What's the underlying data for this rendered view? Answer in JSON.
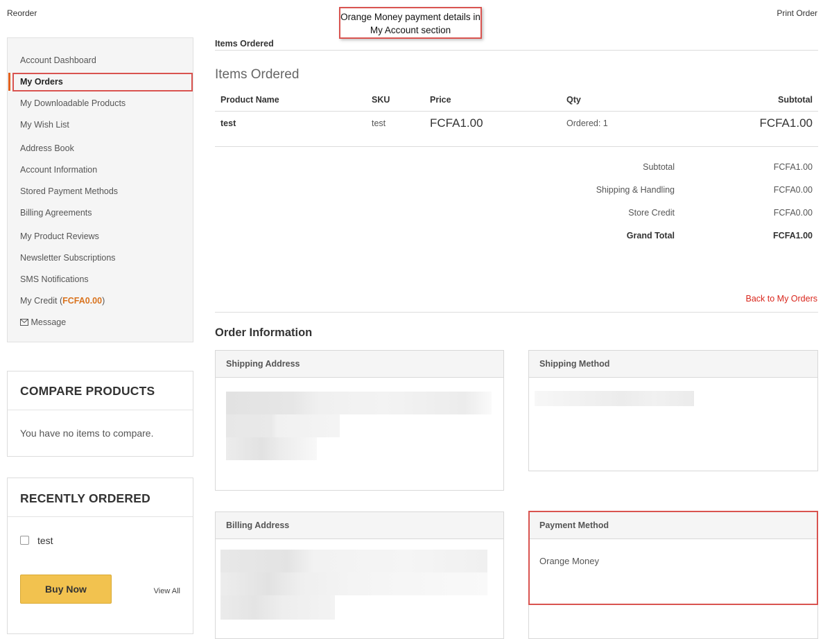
{
  "topbar": {
    "reorder": "Reorder",
    "print_order": "Print Order",
    "callout": "Orange Money payment details in My Account section"
  },
  "sidebar": {
    "items": [
      {
        "label": "Account Dashboard"
      },
      {
        "label": "My Orders"
      },
      {
        "label": "My Downloadable Products"
      },
      {
        "label": "My Wish List"
      },
      {
        "label": "Address Book"
      },
      {
        "label": "Account Information"
      },
      {
        "label": "Stored Payment Methods"
      },
      {
        "label": "Billing Agreements"
      },
      {
        "label": "My Product Reviews"
      },
      {
        "label": "Newsletter Subscriptions"
      },
      {
        "label": "SMS Notifications"
      },
      {
        "label": "My Credit (",
        "value": "FCFA0.00",
        "suffix": ")"
      },
      {
        "label": "Message"
      }
    ],
    "accent_color": "#e2611e"
  },
  "compare": {
    "title": "COMPARE PRODUCTS",
    "empty": "You have no items to compare."
  },
  "recent": {
    "title": "RECENTLY ORDERED",
    "item": "test",
    "buy_now": "Buy Now",
    "view_all": "View All"
  },
  "order": {
    "tab": "Items Ordered",
    "heading": "Items Ordered",
    "columns": {
      "name": "Product Name",
      "sku": "SKU",
      "price": "Price",
      "qty": "Qty",
      "subtotal": "Subtotal"
    },
    "rows": [
      {
        "name": "test",
        "sku": "test",
        "price": "FCFA1.00",
        "qty": "Ordered: 1",
        "subtotal": "FCFA1.00"
      }
    ],
    "totals": [
      {
        "label": "Subtotal",
        "value": "FCFA1.00"
      },
      {
        "label": "Shipping & Handling",
        "value": "FCFA0.00"
      },
      {
        "label": "Store Credit",
        "value": "FCFA0.00"
      },
      {
        "label": "Grand Total",
        "value": "FCFA1.00"
      }
    ],
    "back": "Back to My Orders"
  },
  "info": {
    "title": "Order Information",
    "shipping_address": "Shipping Address",
    "shipping_method": "Shipping Method",
    "billing_address": "Billing Address",
    "payment_method": "Payment Method",
    "payment_value": "Orange Money"
  },
  "colors": {
    "highlight": "#d9534f",
    "link_red": "#d9261c",
    "button": "#f2c24f"
  },
  "icons": {
    "message": "envelope-icon",
    "checkbox": "checkbox"
  }
}
